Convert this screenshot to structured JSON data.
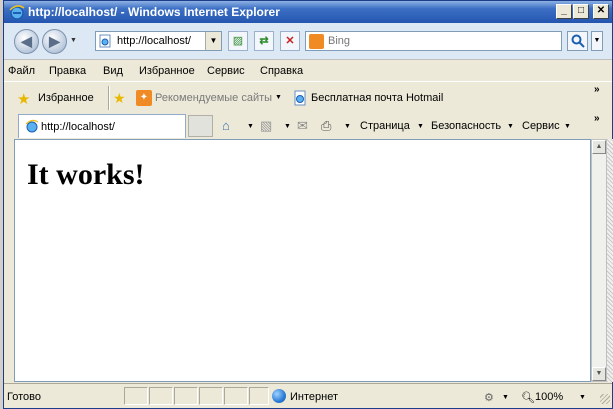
{
  "window": {
    "title": "http://localhost/ - Windows Internet Explorer",
    "controls": {
      "minimize": "_",
      "maximize": "□",
      "close": "✕"
    }
  },
  "address_bar": {
    "url": "http://localhost/",
    "search_placeholder": "Bing"
  },
  "menu": {
    "items": [
      "Файл",
      "Правка",
      "Вид",
      "Избранное",
      "Сервис",
      "Справка"
    ]
  },
  "favorites_bar": {
    "favorites_label": "Избранное",
    "suggested_sites_label": "Рекомендуемые сайты",
    "hotmail_label": "Бесплатная почта Hotmail"
  },
  "tab": {
    "title": "http://localhost/"
  },
  "command_bar": {
    "page_label": "Страница",
    "safety_label": "Безопасность",
    "tools_label": "Сервис"
  },
  "content": {
    "heading": "It works!"
  },
  "status_bar": {
    "status": "Готово",
    "zone": "Интернет",
    "zoom": "100%"
  },
  "icons": {
    "back": "back-icon",
    "forward": "forward-icon",
    "refresh": "refresh-icon",
    "stop": "stop-icon",
    "search": "search-icon",
    "home": "home-icon",
    "feeds": "rss-icon",
    "mail": "mail-icon",
    "print": "printer-icon",
    "favorites": "star-icon",
    "zone": "globe-icon"
  },
  "colors": {
    "title_bar": "#2456b0",
    "address_row": "#dde8f5",
    "chrome": "#ece9d8",
    "bing_orange": "#f08a24"
  }
}
